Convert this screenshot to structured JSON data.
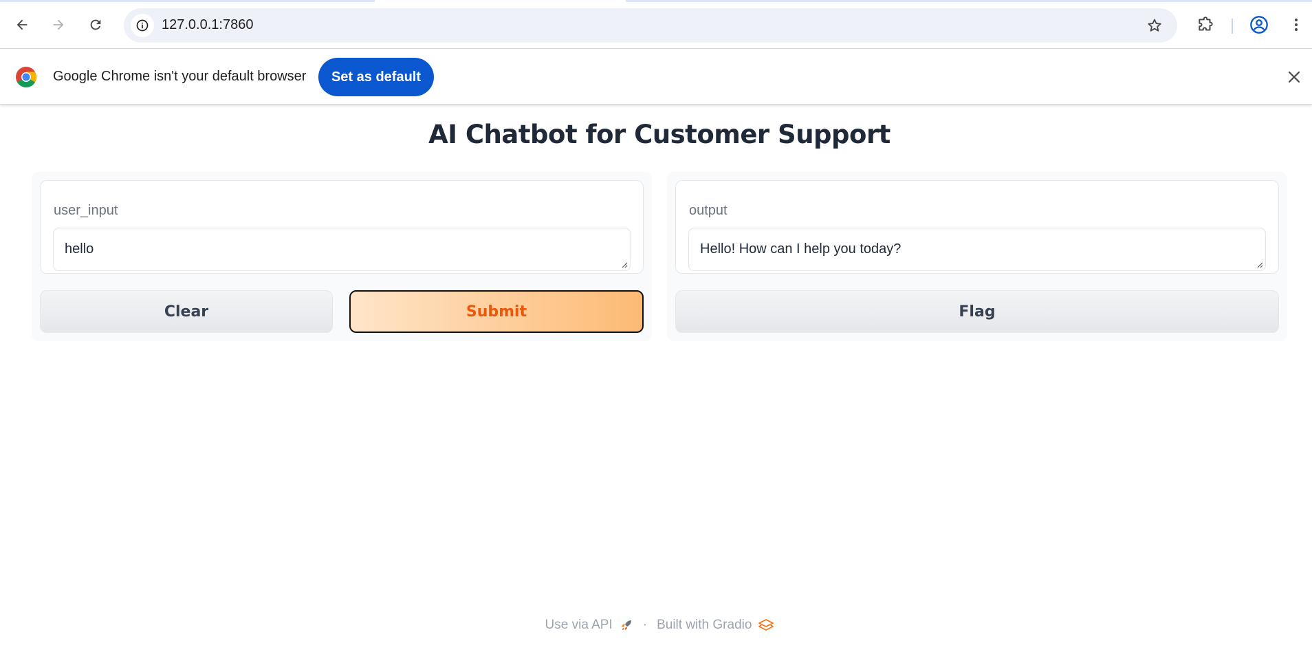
{
  "browser": {
    "url": "127.0.0.1:7860"
  },
  "infobar": {
    "message": "Google Chrome isn't your default browser",
    "button_label": "Set as default",
    "colors": {
      "button": "#0b57d0"
    }
  },
  "app": {
    "title": "AI Chatbot for Customer Support",
    "input": {
      "label": "user_input",
      "value": "hello"
    },
    "output": {
      "label": "output",
      "value": "Hello! How can I help you today?"
    },
    "buttons": {
      "clear": "Clear",
      "submit": "Submit",
      "flag": "Flag"
    },
    "colors": {
      "primary_text": "#ea580c",
      "primary_gradient_start": "#ffe5c9",
      "primary_gradient_end": "#fdba74"
    }
  },
  "footer": {
    "api_link": "Use via API",
    "separator": "·",
    "built_with": "Built with Gradio"
  },
  "icons": [
    "back-arrow-icon",
    "forward-arrow-icon",
    "reload-icon",
    "site-info-icon",
    "bookmark-star-icon",
    "extensions-icon",
    "profile-icon",
    "menu-dots-icon",
    "chrome-logo-icon",
    "close-icon",
    "rocket-icon",
    "gradio-logo-icon"
  ]
}
